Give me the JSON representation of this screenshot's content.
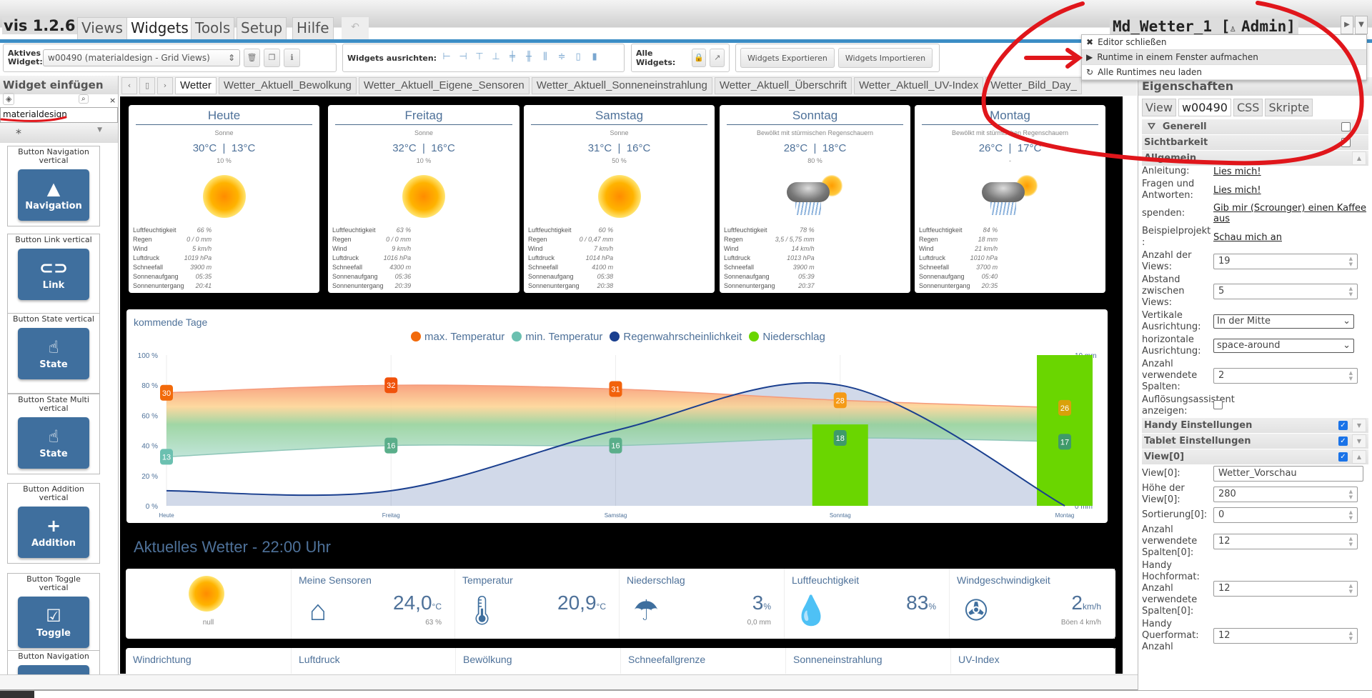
{
  "app": {
    "brand": "vis 1.2.6",
    "menu_tabs": [
      "Views",
      "Widgets",
      "Tools",
      "Setup",
      "Hilfe"
    ],
    "active_menu_tab": "Widgets",
    "undo_icon": "undo-icon",
    "project_title": "Md_Wetter_1 [",
    "user_icon": "user-icon",
    "user": "Admin]"
  },
  "dropdown_menu": {
    "items": [
      {
        "icon": "✖",
        "label": "Editor schließen"
      },
      {
        "icon": "▶",
        "label": "Runtime in einem Fenster aufmachen"
      },
      {
        "icon": "↻",
        "label": "Alle Runtimes neu laden"
      }
    ]
  },
  "toolbar": {
    "active_widget_label": "Aktives Widget:",
    "active_widget_value": "w00490 (materialdesign - Grid Views)",
    "align_label": "Widgets ausrichten:",
    "all_widgets_label": "Alle Widgets:",
    "export_label": "Widgets Exportieren",
    "import_label": "Widgets Importieren"
  },
  "sidebar": {
    "title": "Widget einfügen",
    "filter_value": "materialdesign",
    "set_value": "*",
    "widgets": [
      {
        "title": "Button Navigation vertical",
        "label": "Navigation",
        "icon": "▲"
      },
      {
        "title": "Button Link vertical",
        "label": "Link",
        "icon": "⊂⊃"
      },
      {
        "title": "Button State vertical",
        "label": "State",
        "icon": "☝"
      },
      {
        "title": "Button State Multi vertical",
        "label": "State",
        "icon": "☝"
      },
      {
        "title": "Button Addition vertical",
        "label": "Addition",
        "icon": "+"
      },
      {
        "title": "Button Toggle vertical",
        "label": "Toggle",
        "icon": "☑"
      },
      {
        "title": "Button Navigation",
        "label": "Navigation",
        "icon": "▲"
      }
    ]
  },
  "view_tabs": [
    "Wetter",
    "Wetter_Aktuell_Bewolkung",
    "Wetter_Aktuell_Eigene_Sensoren",
    "Wetter_Aktuell_Sonneneinstrahlung",
    "Wetter_Aktuell_Überschrift",
    "Wetter_Aktuell_UV-Index",
    "Wetter_Bild_Day_"
  ],
  "forecast": {
    "row_labels": [
      "Luftfeuchtigkeit",
      "Regen",
      "Wind",
      "Luftdruck",
      "Schneefall",
      "Sonnenaufgang",
      "Sonnenuntergang"
    ],
    "days": [
      {
        "day": "Heute",
        "condition": "Sonne",
        "temps": "30°C  |  13°C",
        "rain_prob": "10 %",
        "icon": "sun",
        "values": [
          "66 %",
          "0 / 0 mm",
          "5 km/h",
          "1019 hPa",
          "3900 m",
          "05:35",
          "20:41"
        ]
      },
      {
        "day": "Freitag",
        "condition": "Sonne",
        "temps": "32°C  |  16°C",
        "rain_prob": "10 %",
        "icon": "sun",
        "values": [
          "63 %",
          "0 / 0 mm",
          "9 km/h",
          "1016 hPa",
          "4300 m",
          "05:36",
          "20:39"
        ]
      },
      {
        "day": "Samstag",
        "condition": "Sonne",
        "temps": "31°C  |  16°C",
        "rain_prob": "50 %",
        "icon": "sun",
        "values": [
          "60 %",
          "0 / 0,47 mm",
          "7 km/h",
          "1014 hPa",
          "4100 m",
          "05:38",
          "20:38"
        ]
      },
      {
        "day": "Sonntag",
        "condition": "Bewölkt mit stürmischen Regenschauern",
        "temps": "28°C  |  18°C",
        "rain_prob": "80 %",
        "icon": "cloud-rain-sun",
        "values": [
          "78 %",
          "3,5 / 5,75 mm",
          "14 km/h",
          "1013 hPa",
          "3900 m",
          "05:39",
          "20:37"
        ]
      },
      {
        "day": "Montag",
        "condition": "Bewölkt mit stürmischen Regenschauern",
        "temps": "26°C  |  17°C",
        "rain_prob": "-",
        "icon": "cloud-rain-sun",
        "values": [
          "84 %",
          "18 mm",
          "21 km/h",
          "1010 hPa",
          "3700 m",
          "05:40",
          "20:35"
        ]
      }
    ]
  },
  "chart_data": {
    "type": "line",
    "title": "kommende Tage",
    "categories": [
      "Heute",
      "Freitag",
      "Samstag",
      "Sonntag",
      "Montag"
    ],
    "y_left": {
      "ticks": [
        "0 %",
        "20 %",
        "40 %",
        "60 %",
        "80 %",
        "100 %"
      ],
      "range": [
        0,
        100
      ]
    },
    "y_right": {
      "ticks": [
        "0 mm",
        "2 mm",
        "4 mm",
        "6 mm",
        "8 mm",
        "10 mm"
      ],
      "range": [
        0,
        10
      ]
    },
    "legend_position": "top",
    "series": [
      {
        "name": "max. Temperatur",
        "type": "area-band",
        "values": [
          30,
          32,
          31,
          28,
          26
        ],
        "color": "#f26a0b"
      },
      {
        "name": "min. Temperatur",
        "type": "area-band",
        "values": [
          13,
          16,
          16,
          18,
          17
        ],
        "color": "#6bc0b0"
      },
      {
        "name": "Regenwahrscheinlichkeit",
        "type": "area",
        "axis": "left",
        "values": [
          10,
          10,
          50,
          80,
          0
        ],
        "color": "#1a3f8f"
      },
      {
        "name": "Niederschlag",
        "type": "bar",
        "axis": "right",
        "values": [
          0,
          0,
          0,
          5.4,
          10
        ],
        "color": "#6ad600"
      }
    ]
  },
  "current": {
    "title": "Aktuelles Wetter - 22:00 Uhr",
    "sun_label": "null",
    "tiles": [
      {
        "title": "Meine Sensoren",
        "icon": "house-thermometer-icon",
        "value": "24,0",
        "unit": "°C",
        "sub": "63 %"
      },
      {
        "title": "Temperatur",
        "icon": "thermometer-icon",
        "value": "20,9",
        "unit": "°C",
        "sub": ""
      },
      {
        "title": "Niederschlag",
        "icon": "cloud-rain-icon",
        "value": "3",
        "unit": "%",
        "sub": "0,0 mm"
      },
      {
        "title": "Luftfeuchtigkeit",
        "icon": "water-drop-icon",
        "value": "83",
        "unit": "%",
        "sub": ""
      },
      {
        "title": "Windgeschwindigkeit",
        "icon": "wind-turbine-icon",
        "value": "2",
        "unit": "km/h",
        "sub": "Böen 4 km/h"
      }
    ],
    "row2": [
      "Windrichtung",
      "Luftdruck",
      "Bewölkung",
      "Schneefallgrenze",
      "Sonneneinstrahlung",
      "UV-Index"
    ]
  },
  "props": {
    "title": "Eigenschaften",
    "tabs": [
      "View",
      "w00490",
      "CSS",
      "Skripte"
    ],
    "active_tab": "w00490",
    "sections": {
      "generell": "Generell",
      "sichtbarkeit": "Sichtbarkeit",
      "allgemein": "Allgemein",
      "handy": "Handy Einstellungen",
      "tablet": "Tablet Einstellungen",
      "view0": "View[0]"
    },
    "rows": {
      "anleitung": {
        "label": "Anleitung:",
        "link": "Lies mich!"
      },
      "faq": {
        "label": "Fragen und Antworten:",
        "link": "Lies mich!"
      },
      "spenden": {
        "label": "spenden:",
        "link": "Gib mir (Scrounger) einen Kaffee aus"
      },
      "beispiel": {
        "label": "Beispielprojekt :",
        "link": "Schau mich an"
      },
      "views": {
        "label": "Anzahl der Views:",
        "value": "19"
      },
      "abstand": {
        "label": "Abstand zwischen Views:",
        "value": "5"
      },
      "vertikal": {
        "label": "Vertikale Ausrichtung:",
        "value": "In der Mitte"
      },
      "horizontal": {
        "label": "horizontale Ausrichtung:",
        "value": "space-around"
      },
      "spalten": {
        "label": "Anzahl verwendete Spalten:",
        "value": "2"
      },
      "aufloesung": {
        "label": "Auflösungsassistent anzeigen:",
        "checked": false
      },
      "view0": {
        "label": "View[0]:",
        "value": "Wetter_Vorschau"
      },
      "hoehe": {
        "label": "Höhe der View[0]:",
        "value": "280"
      },
      "sort": {
        "label": "Sortierung[0]:",
        "value": "0"
      },
      "spalten0": {
        "label": "Anzahl verwendete Spalten[0]:",
        "value": "12"
      },
      "hoch": {
        "label": "Handy Hochformat: Anzahl verwendete Spalten[0]:",
        "value": "12"
      },
      "quer": {
        "label": "Handy Querformat: Anzahl",
        "value": "12"
      }
    },
    "checks": {
      "handy": true,
      "tablet": true,
      "view0": true,
      "generell": false,
      "sichtbarkeit": false
    }
  }
}
